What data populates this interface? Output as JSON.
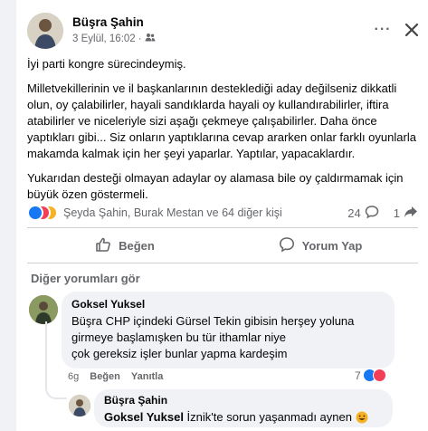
{
  "post": {
    "author": "Büşra Şahin",
    "timestamp": "3 Eylül, 16:02",
    "separator": "·",
    "audience_icon": "friends-icon",
    "paragraphs": [
      "İyi parti kongre sürecindeymiş.",
      "Milletvekillerinin ve il başkanlarının desteklediği aday değilseniz dikkatli olun, oy çalabilirler, hayali sandıklarda hayali oy kullandırabilirler, iftira atabilirler ve niceleriyle sizi aşağı çekmeye çalışabilirler. Daha önce yaptıkları gibi... Siz onların yaptıklarına cevap ararken onlar farklı oyunlarla makamda kalmak için her şeyi yaparlar. Yaptılar, yapacaklardır.",
      "Yukarıdan desteği olmayan adaylar oy alamasa bile oy çaldırmamak için büyük özen göstermeli."
    ],
    "reactors": "Şeyda Şahin, Burak Mestan ve 64 diğer kişi",
    "comment_count": "24",
    "share_count": "1",
    "actions": {
      "like": "Beğen",
      "comment": "Yorum Yap"
    }
  },
  "comments": {
    "see_more": "Diğer yorumları gör",
    "items": [
      {
        "author": "Goksel Yuksel",
        "lines": [
          "Büşra CHP içindeki Gürsel Tekin gibisin herşey yoluna",
          "girmeye başlamışken bu tür ithamlar niye",
          "çok gereksiz işler bunlar yapma kardeşim"
        ],
        "age": "6g",
        "like": "Beğen",
        "reply": "Yanıtla",
        "reaction_count": "7"
      }
    ],
    "reply": {
      "author": "Büşra Şahin",
      "tag": "Goksel Yuksel",
      "text": " İznik'te sorun yaşanmadı aynen"
    }
  },
  "colors": {
    "like_blue": "#1877f2",
    "love_red": "#f33e58",
    "haha_yellow": "#f7b125",
    "muted": "#65676b"
  }
}
